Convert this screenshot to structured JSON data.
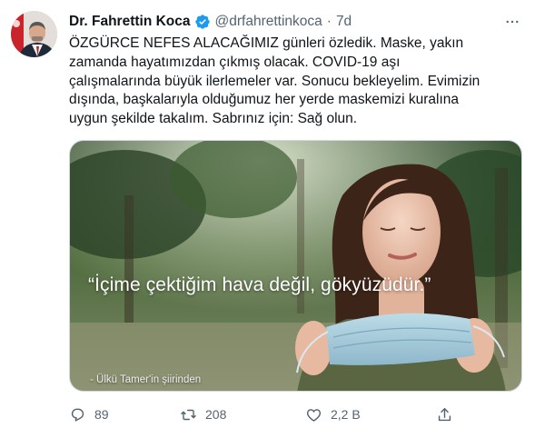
{
  "author": {
    "name": "Dr. Fahrettin Koca",
    "handle": "@drfahrettinkoca",
    "separator": "·",
    "time": "7d"
  },
  "tweet_lines": [
    "ÖZGÜRCE NEFES ALACAĞIMIZ günleri özledik. Maske, yakın",
    "zamanda hayatımızdan çıkmış olacak. COVID-19 aşı",
    "çalışmalarında büyük ilerlemeler var. Sonucu bekleyelim. Evimizin",
    "dışında, başkalarıyla olduğumuz her yerde maskemizi kuralına",
    "uygun şekilde takalım. Sabrınız için: Sağ olun."
  ],
  "media": {
    "quote": "“İçime çektiğim hava değil, gökyüzüdür.”",
    "credit": "- Ülkü Tamer'in şiirinden"
  },
  "actions": {
    "replies": "89",
    "retweets": "208",
    "likes": "2,2 B"
  },
  "colors": {
    "verified": "#1d9bf0",
    "muted": "#536471",
    "text": "#0f1419"
  },
  "icons": [
    "verified-badge-icon",
    "more-icon",
    "reply-icon",
    "retweet-icon",
    "like-icon",
    "share-icon"
  ]
}
